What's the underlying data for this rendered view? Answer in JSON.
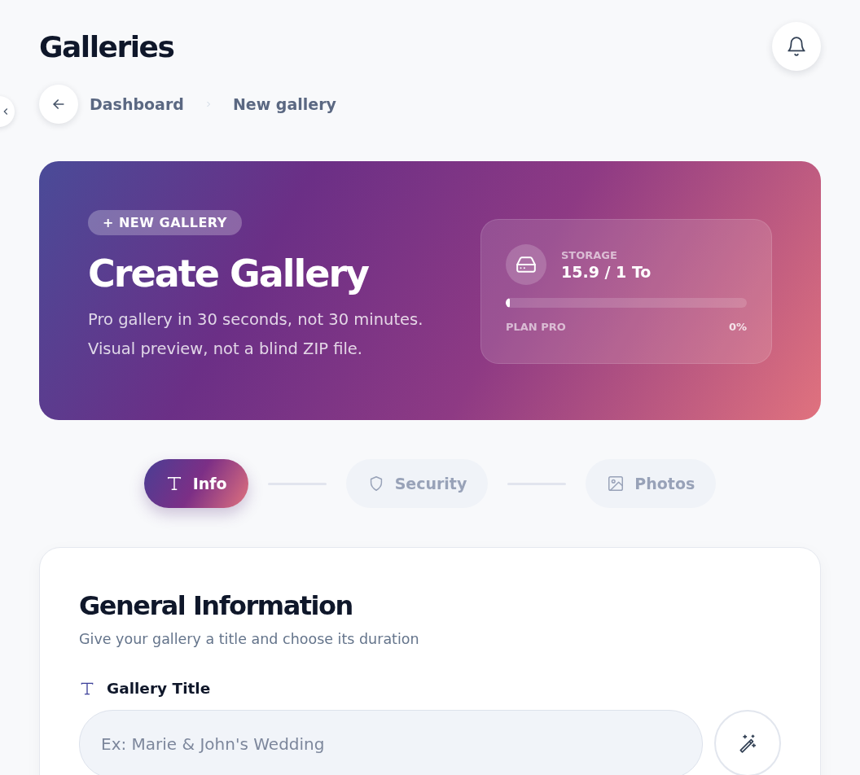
{
  "page_title": "Galleries",
  "breadcrumb": [
    "Dashboard",
    "New gallery"
  ],
  "hero": {
    "badge": "+ NEW GALLERY",
    "title": "Create Gallery",
    "subtitle_lines": [
      "Pro gallery in 30 seconds, not 30 minutes.",
      "Visual preview, not a blind ZIP file."
    ],
    "storage": {
      "label": "STORAGE",
      "value": "15.9 / 1 To",
      "level": 0.016,
      "plan": "PLAN PRO",
      "percent": "0%"
    }
  },
  "steps": [
    {
      "label": "Info",
      "selected": true
    },
    {
      "label": "Security",
      "selected": false
    },
    {
      "label": "Photos",
      "selected": false
    }
  ],
  "form": {
    "title": "General Information",
    "subtitle": "Give your gallery a title and choose its duration",
    "field_label": "Gallery Title",
    "placeholder": "Ex: Marie & John's Wedding"
  }
}
